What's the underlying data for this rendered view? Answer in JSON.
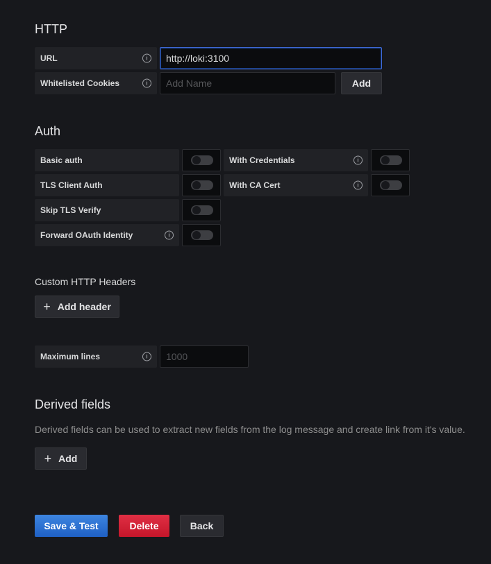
{
  "http": {
    "title": "HTTP",
    "url_label": "URL",
    "url_value": "http://loki:3100",
    "cookies_label": "Whitelisted Cookies",
    "cookies_placeholder": "Add Name",
    "add_label": "Add"
  },
  "auth": {
    "title": "Auth",
    "basic_auth": "Basic auth",
    "with_credentials": "With Credentials",
    "tls_client_auth": "TLS Client Auth",
    "with_ca_cert": "With CA Cert",
    "skip_tls_verify": "Skip TLS Verify",
    "forward_oauth": "Forward OAuth Identity",
    "toggles": {
      "basic_auth": false,
      "with_credentials": false,
      "tls_client_auth": false,
      "with_ca_cert": false,
      "skip_tls_verify": false,
      "forward_oauth": false
    }
  },
  "headers": {
    "title": "Custom HTTP Headers",
    "add_header_label": "Add header"
  },
  "max_lines": {
    "label": "Maximum lines",
    "placeholder": "1000"
  },
  "derived": {
    "title": "Derived fields",
    "description": "Derived fields can be used to extract new fields from the log message and create link from it's value.",
    "add_label": "Add"
  },
  "actions": {
    "save_label": "Save & Test",
    "delete_label": "Delete",
    "back_label": "Back"
  },
  "colors": {
    "primary": "#3274d9",
    "danger": "#d10e2b",
    "background": "#17181c"
  }
}
